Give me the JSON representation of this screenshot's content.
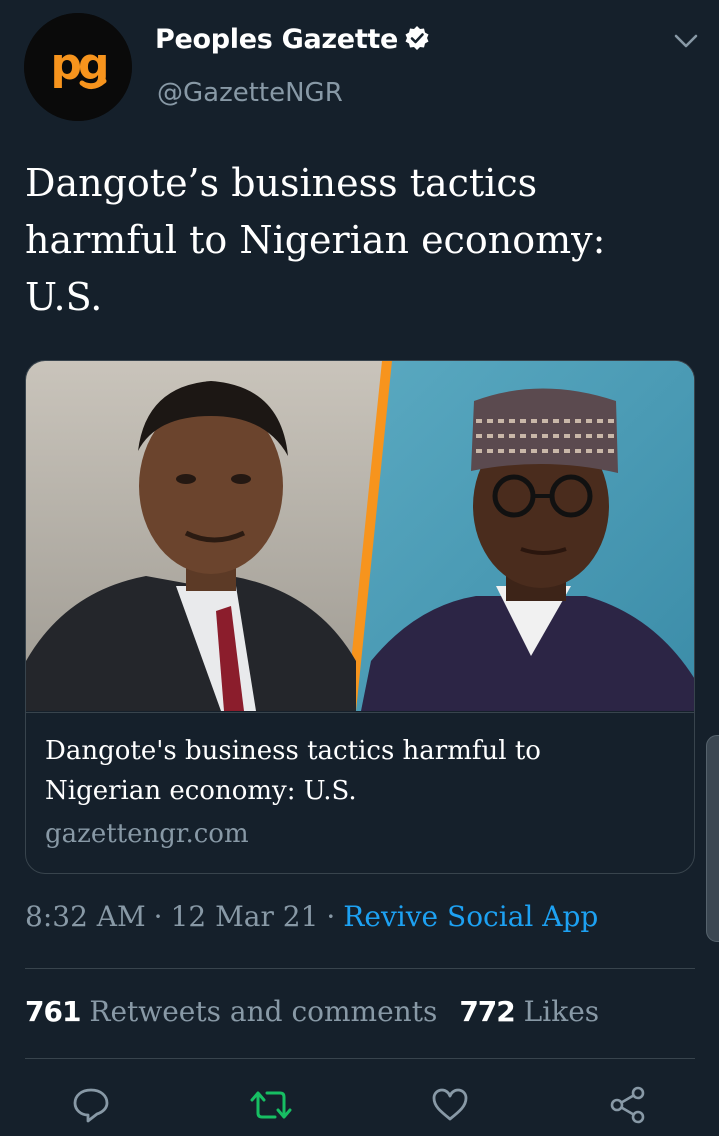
{
  "account": {
    "name": "Peoples Gazette",
    "handle": "@GazetteNGR",
    "avatar_text": "pg"
  },
  "tweet": {
    "text": "Dangote’s business tactics harmful to Nigerian economy: U.S."
  },
  "card": {
    "title": "Dangote's business tactics harmful to Nigerian economy: U.S.",
    "domain": "gazettengr.com"
  },
  "meta": {
    "time": "8:32 AM",
    "separator": "·",
    "date": "12 Mar 21",
    "source": "Revive Social App"
  },
  "stats": {
    "retweets_count": "761",
    "retweets_label": "Retweets and comments",
    "likes_count": "772",
    "likes_label": "Likes"
  },
  "actions": [
    "comment-icon",
    "retweet-icon",
    "like-icon",
    "share-icon"
  ],
  "colors": {
    "background": "#15202b",
    "accent": "#1da1f2",
    "retweet_active": "#17bf63",
    "muted": "#8899a6",
    "border": "#38444d",
    "logo_orange": "#f7941d"
  }
}
